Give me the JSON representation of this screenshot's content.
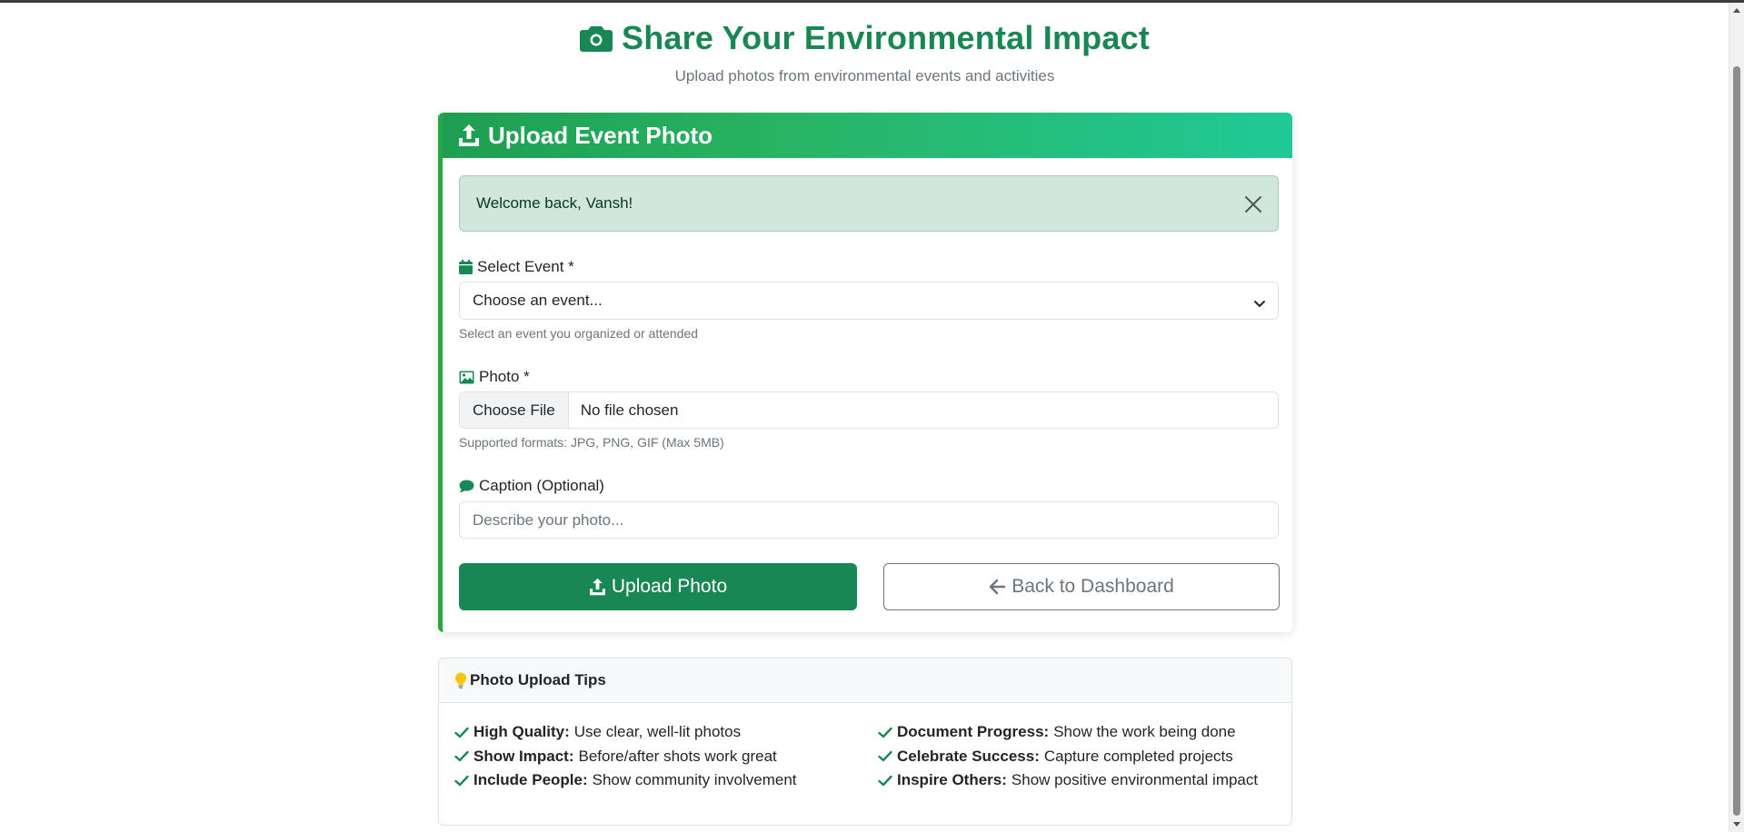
{
  "header": {
    "title": "Share Your Environmental Impact",
    "subtitle": "Upload photos from environmental events and activities",
    "icon": "camera-icon"
  },
  "upload_card": {
    "title": "Upload Event Photo",
    "alert": {
      "message": "Welcome back, Vansh!"
    },
    "event_field": {
      "label": "Select Event *",
      "selected": "Choose an event...",
      "help": "Select an event you organized or attended"
    },
    "photo_field": {
      "label": "Photo *",
      "button": "Choose File",
      "value": "No file chosen",
      "help": "Supported formats: JPG, PNG, GIF (Max 5MB)"
    },
    "caption_field": {
      "label": "Caption (Optional)",
      "placeholder": "Describe your photo..."
    },
    "upload_button": "Upload Photo",
    "back_button": "Back to Dashboard"
  },
  "tips": {
    "title": "Photo Upload Tips",
    "left": [
      {
        "title": "High Quality:",
        "text": "Use clear, well-lit photos"
      },
      {
        "title": "Show Impact:",
        "text": "Before/after shots work great"
      },
      {
        "title": "Include People:",
        "text": "Show community involvement"
      }
    ],
    "right": [
      {
        "title": "Document Progress:",
        "text": "Show the work being done"
      },
      {
        "title": "Celebrate Success:",
        "text": "Capture completed projects"
      },
      {
        "title": "Inspire Others:",
        "text": "Show positive environmental impact"
      }
    ]
  },
  "colors": {
    "primary": "#198754",
    "header_gradient_end": "#20c997",
    "alert_bg": "#d1e7dd",
    "muted": "#6c757d"
  }
}
